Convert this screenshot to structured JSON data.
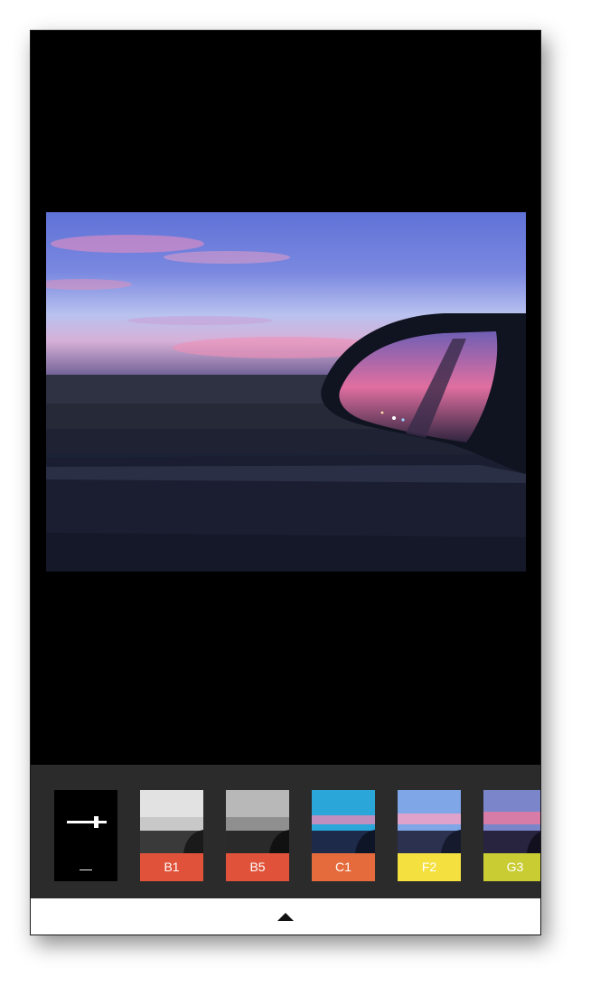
{
  "editor": {
    "photo_alt": "photo preview"
  },
  "filters": {
    "adjust": {
      "label": "—",
      "icon": "adjust-sliders-icon"
    },
    "items": [
      {
        "label": "B1",
        "color": "#e0533a",
        "thumb": "bw"
      },
      {
        "label": "B5",
        "color": "#e0533a",
        "thumb": "bw-dark"
      },
      {
        "label": "C1",
        "color": "#e66b3c",
        "thumb": "cyan"
      },
      {
        "label": "F2",
        "color": "#f4e03f",
        "thumb": "pastel"
      },
      {
        "label": "G3",
        "color": "#c9cc33",
        "thumb": "sunset"
      }
    ]
  },
  "bottom_bar": {
    "expand_icon": "triangle-up-icon"
  }
}
